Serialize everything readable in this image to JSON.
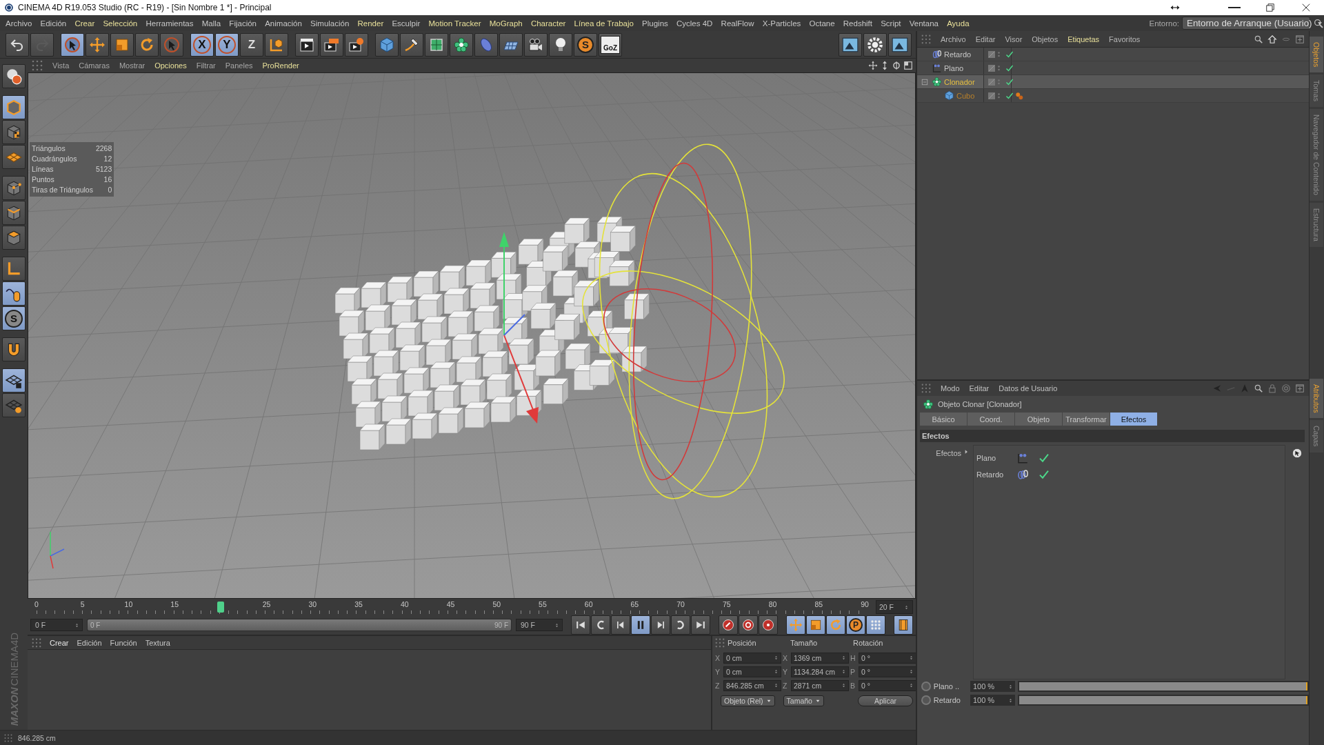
{
  "window": {
    "title": "CINEMA 4D R19.053 Studio (RC - R19) - [Sin Nombre 1 *] - Principal"
  },
  "menu": [
    {
      "label": "Archivo",
      "highlight": false
    },
    {
      "label": "Edición",
      "highlight": false
    },
    {
      "label": "Crear",
      "highlight": true
    },
    {
      "label": "Selección",
      "highlight": true
    },
    {
      "label": "Herramientas",
      "highlight": false
    },
    {
      "label": "Malla",
      "highlight": false
    },
    {
      "label": "Fijación",
      "highlight": false
    },
    {
      "label": "Animación",
      "highlight": false
    },
    {
      "label": "Simulación",
      "highlight": false
    },
    {
      "label": "Render",
      "highlight": true
    },
    {
      "label": "Esculpir",
      "highlight": false
    },
    {
      "label": "Motion Tracker",
      "highlight": true
    },
    {
      "label": "MoGraph",
      "highlight": true
    },
    {
      "label": "Character",
      "highlight": true
    },
    {
      "label": "Línea de Trabajo",
      "highlight": true
    },
    {
      "label": "Plugins",
      "highlight": false
    },
    {
      "label": "Cycles 4D",
      "highlight": false
    },
    {
      "label": "RealFlow",
      "highlight": false
    },
    {
      "label": "X-Particles",
      "highlight": false
    },
    {
      "label": "Octane",
      "highlight": false
    },
    {
      "label": "Redshift",
      "highlight": false
    },
    {
      "label": "Script",
      "highlight": false
    },
    {
      "label": "Ventana",
      "highlight": false
    },
    {
      "label": "Ayuda",
      "highlight": true
    }
  ],
  "environment": {
    "label": "Entorno:",
    "value": "Entorno de Arranque (Usuario)"
  },
  "toolbar": [
    [
      {
        "kind": "undo",
        "selected": false
      },
      {
        "kind": "redo",
        "selected": false
      }
    ],
    [
      {
        "kind": "select",
        "selected": true
      },
      {
        "kind": "move",
        "selected": false
      },
      {
        "kind": "scale",
        "selected": false
      },
      {
        "kind": "rotate",
        "selected": false
      },
      {
        "kind": "recent",
        "selected": false
      }
    ],
    [
      {
        "kind": "axis",
        "label": "X",
        "selected": true
      },
      {
        "kind": "axis",
        "label": "Y",
        "selected": true
      },
      {
        "kind": "axis",
        "label": "Z",
        "selected": false
      },
      {
        "kind": "world",
        "selected": false
      }
    ],
    [
      {
        "kind": "render-view",
        "selected": false
      },
      {
        "kind": "render",
        "selected": false
      },
      {
        "kind": "render-settings",
        "selected": false
      }
    ],
    [
      {
        "kind": "cube",
        "selected": false
      },
      {
        "kind": "pen",
        "selected": false
      },
      {
        "kind": "subdivide",
        "selected": false
      },
      {
        "kind": "cloner",
        "selected": false
      },
      {
        "kind": "deformer",
        "selected": false
      },
      {
        "kind": "floor",
        "selected": false
      },
      {
        "kind": "camera",
        "selected": false
      },
      {
        "kind": "light",
        "selected": false
      },
      {
        "kind": "sculpt",
        "label": "S",
        "selected": false
      },
      {
        "kind": "goz",
        "label": "GoZ",
        "selected": false
      }
    ]
  ],
  "toolbar_right": [
    {
      "kind": "layout",
      "selected": false
    },
    {
      "kind": "gear",
      "selected": false
    },
    {
      "kind": "layout",
      "selected": false
    }
  ],
  "left_tools": [
    [
      {
        "kind": "make-editable",
        "selected": false
      }
    ],
    [
      {
        "kind": "model",
        "selected": true
      },
      {
        "kind": "texture",
        "selected": false
      },
      {
        "kind": "workplane",
        "selected": false
      }
    ],
    [
      {
        "kind": "points",
        "selected": false
      },
      {
        "kind": "edges",
        "selected": false
      },
      {
        "kind": "polygons",
        "selected": false
      }
    ],
    [
      {
        "kind": "axis-mode",
        "selected": false
      },
      {
        "kind": "tweak",
        "selected": true
      },
      {
        "kind": "solo",
        "label": "S",
        "selected": true
      }
    ],
    [
      {
        "kind": "snap",
        "selected": false
      }
    ],
    [
      {
        "kind": "lock-grid",
        "selected": true
      },
      {
        "kind": "grid-snap",
        "selected": false
      }
    ]
  ],
  "viewport": {
    "menu": [
      {
        "label": "Vista",
        "highlight": false
      },
      {
        "label": "Cámaras",
        "highlight": false
      },
      {
        "label": "Mostrar",
        "highlight": false
      },
      {
        "label": "Opciones",
        "highlight": true
      },
      {
        "label": "Filtrar",
        "highlight": false
      },
      {
        "label": "Paneles",
        "highlight": false
      },
      {
        "label": "ProRender",
        "highlight": true
      }
    ],
    "stats": [
      {
        "label": "Triángulos",
        "value": "2268"
      },
      {
        "label": "Cuadrángulos",
        "value": "12"
      },
      {
        "label": "Líneas",
        "value": "5123"
      },
      {
        "label": "Puntos",
        "value": "16"
      },
      {
        "label": "Tiras de Triángulos",
        "value": "0"
      }
    ]
  },
  "timeline": {
    "ticks": [
      "0",
      "5",
      "10",
      "15",
      "25",
      "30",
      "35",
      "40",
      "45",
      "50",
      "55",
      "60",
      "65",
      "70",
      "75",
      "80",
      "85",
      "90"
    ],
    "level": 0.2222,
    "frame": "20 F"
  },
  "playback": {
    "start": "0 F",
    "range_start": "0 F",
    "range_end": "90 F",
    "level": 1,
    "end": "90 F",
    "buttons": [
      [
        {
          "kind": "first",
          "selected": false
        },
        {
          "kind": "prev-key",
          "selected": false
        },
        {
          "kind": "prev-frame",
          "selected": false
        },
        {
          "kind": "pause",
          "selected": true
        },
        {
          "kind": "next-frame",
          "selected": false
        },
        {
          "kind": "next-key",
          "selected": false
        },
        {
          "kind": "last",
          "selected": false
        }
      ],
      [
        {
          "kind": "record",
          "selected": false
        },
        {
          "kind": "autokey",
          "selected": false
        },
        {
          "kind": "key-selection",
          "selected": false
        }
      ],
      [
        {
          "kind": "key-move",
          "selected": true
        },
        {
          "kind": "key-scale",
          "selected": true
        },
        {
          "kind": "key-rotate",
          "selected": true
        },
        {
          "kind": "key-param",
          "label": "P",
          "selected": true
        },
        {
          "kind": "key-points",
          "selected": true
        }
      ],
      [
        {
          "kind": "timeline-layout",
          "selected": true
        }
      ]
    ]
  },
  "materials": {
    "menu": [
      "Crear",
      "Edición",
      "Función",
      "Textura"
    ]
  },
  "logo": {
    "brand": "MAXON",
    "product": "CINEMA4D"
  },
  "coordinates": {
    "headers": [
      "Posición",
      "Tamaño",
      "Rotación"
    ],
    "rows": [
      {
        "axis": "X",
        "position": "0 cm",
        "size_axis": "X",
        "size": "1369 cm",
        "rotation_axis": "H",
        "rotation": "0 °"
      },
      {
        "axis": "Y",
        "position": "0 cm",
        "size_axis": "Y",
        "size": "1134.284 cm",
        "rotation_axis": "P",
        "rotation": "0 °"
      },
      {
        "axis": "Z",
        "position": "846.285 cm",
        "size_axis": "Z",
        "size": "2871 cm",
        "rotation_axis": "B",
        "rotation": "0 °"
      }
    ],
    "mode": "Objeto (Rel)",
    "size_mode": "Tamaño",
    "apply": "Aplicar"
  },
  "status_bar": {
    "text": "846.285 cm"
  },
  "objects": {
    "menu": [
      {
        "label": "Archivo",
        "highlight": false
      },
      {
        "label": "Editar",
        "highlight": false
      },
      {
        "label": "Visor",
        "highlight": false
      },
      {
        "label": "Objetos",
        "highlight": false
      },
      {
        "label": "Etiquetas",
        "highlight": true
      },
      {
        "label": "Favoritos",
        "highlight": false
      }
    ],
    "tree": [
      {
        "name": "Retardo",
        "kind": "delay",
        "selected": false,
        "parent_selected": false,
        "enabled": true
      },
      {
        "name": "Plano",
        "kind": "plain",
        "selected": false,
        "parent_selected": false,
        "enabled": true
      },
      {
        "name": "Clonador",
        "kind": "cloner",
        "selected": true,
        "parent_selected": false,
        "enabled": true,
        "expanded": true,
        "children": [
          {
            "name": "Cubo",
            "kind": "cube",
            "selected": false,
            "parent_selected": true,
            "enabled": true,
            "tags": [
              {
                "kind": "phong"
              }
            ]
          }
        ]
      }
    ]
  },
  "attributes": {
    "menu": [
      "Modo",
      "Editar",
      "Datos de Usuario"
    ],
    "title": "Objeto Clonar [Clonador]",
    "tabs": [
      {
        "label": "Básico",
        "selected": false
      },
      {
        "label": "Coord.",
        "selected": false
      },
      {
        "label": "Objeto",
        "selected": false
      },
      {
        "label": "Transformar",
        "selected": false
      },
      {
        "label": "Efectos",
        "selected": true
      }
    ],
    "section": "Efectos",
    "field_label": "Efectos",
    "effectors": [
      {
        "name": "Plano",
        "kind": "plain",
        "enabled": true
      },
      {
        "name": "Retardo",
        "kind": "delay",
        "enabled": true
      }
    ],
    "strengths": [
      {
        "name": "Plano ..",
        "value": "100 %",
        "level": 1
      },
      {
        "name": "Retardo",
        "value": "100 %",
        "level": 1
      }
    ]
  },
  "side_tabs": {
    "top": [
      {
        "label": "Objetos",
        "selected": true
      },
      {
        "label": "Tomas",
        "selected": false
      },
      {
        "label": "Navegador de Contenido",
        "selected": false
      },
      {
        "label": "Estructura",
        "selected": false
      }
    ],
    "bottom": [
      {
        "label": "Atributos",
        "selected": true
      },
      {
        "label": "Capas",
        "selected": false
      }
    ]
  }
}
